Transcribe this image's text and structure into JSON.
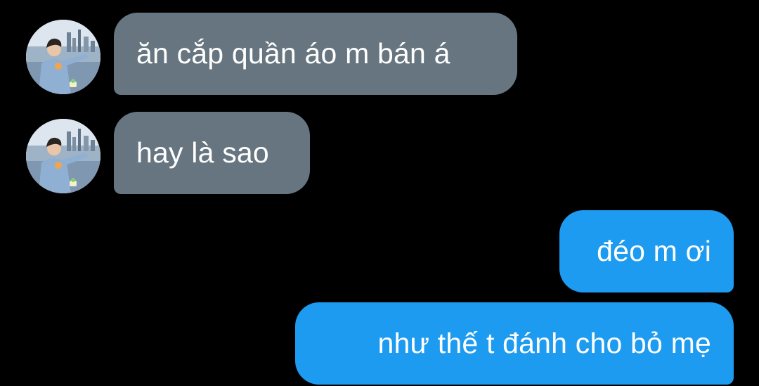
{
  "conversation": {
    "messages": [
      {
        "sender": "other",
        "text": "ăn cắp quần áo m bán á",
        "color": "#66757f",
        "avatar": "profile-photo"
      },
      {
        "sender": "other",
        "text": "hay là sao",
        "color": "#66757f",
        "avatar": "profile-photo"
      },
      {
        "sender": "self",
        "text": "đéo m ơi",
        "color": "#1d9bf0"
      },
      {
        "sender": "self",
        "text": "như thế t đánh cho bỏ mẹ",
        "color": "#1d9bf0"
      }
    ]
  },
  "theme": {
    "background": "#000000",
    "received_bubble": "#66757f",
    "sent_bubble": "#1d9bf0",
    "text": "#ffffff"
  }
}
